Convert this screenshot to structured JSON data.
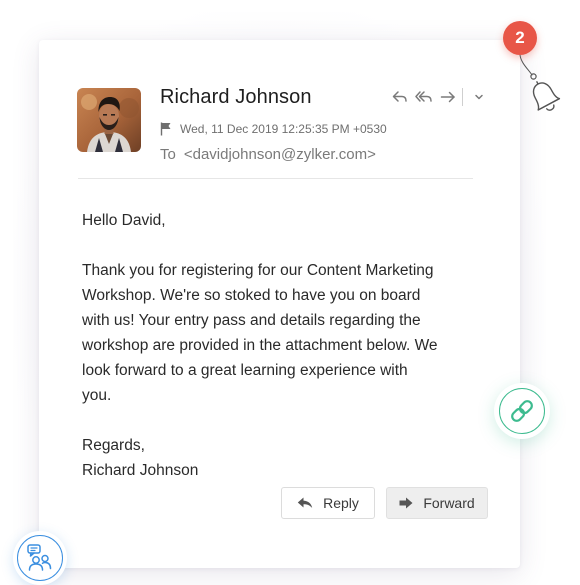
{
  "notification": {
    "badge_count": "2",
    "bell_icon": "bell-icon"
  },
  "email": {
    "sender_name": "Richard Johnson",
    "date": "Wed, 11 Dec 2019 12:25:35 PM +0530",
    "to_label": "To",
    "to_address": "<davidjohnson@zylker.com>",
    "actions": [
      {
        "icon": "reply-icon"
      },
      {
        "icon": "reply-all-icon"
      },
      {
        "icon": "forward-icon"
      },
      {
        "icon": "chevron-down-icon"
      }
    ],
    "greeting": "Hello David,",
    "paragraph": "Thank you for registering for our Content Marketing\nWorkshop. We're so stoked to have you on board\nwith us! Your entry pass and details regarding the\nworkshop are provided in the attachment below. We\nlook forward to a great learning experience with\nyou.",
    "signoff": "Regards,",
    "signature": "Richard Johnson"
  },
  "buttons": {
    "reply_label": "Reply",
    "forward_label": "Forward"
  },
  "floating": {
    "link_icon": "link-icon",
    "users_icon": "users-chat-icon"
  },
  "colors": {
    "badge": "#e85647",
    "link_accent": "#3dbb8f",
    "users_accent": "#3b8fe0",
    "forward_bg": "#eeeeee"
  }
}
